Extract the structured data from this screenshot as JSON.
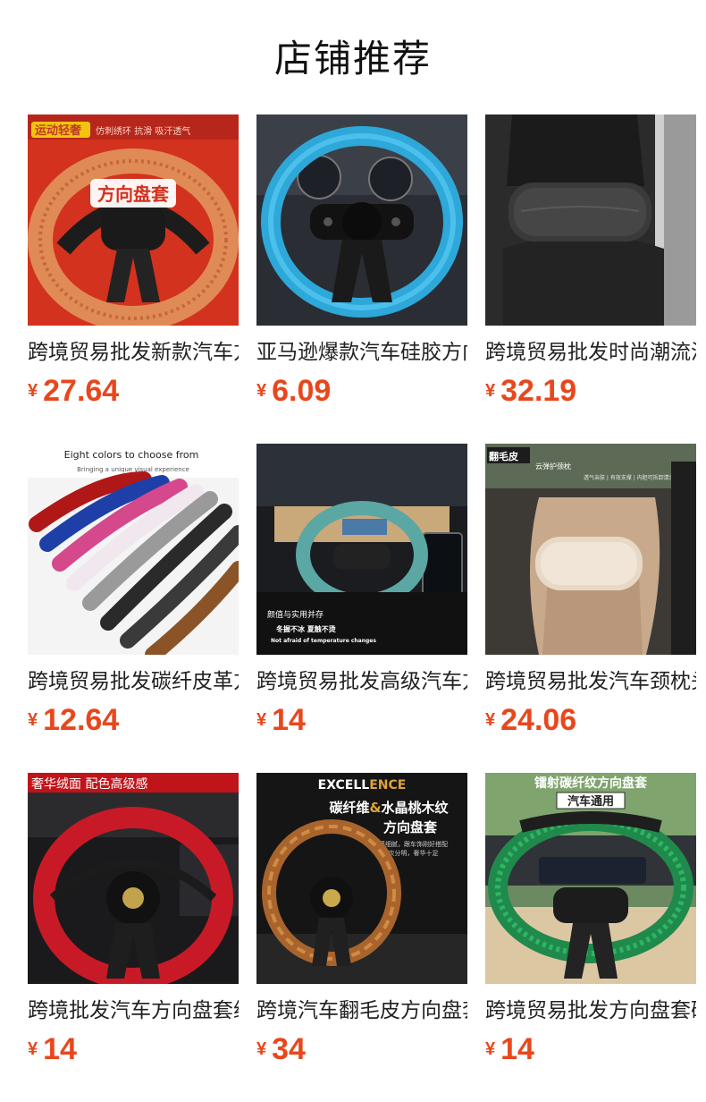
{
  "header": {
    "title": "店铺推荐"
  },
  "currency_symbol": "¥",
  "colors": {
    "price": "#e8471c"
  },
  "products": [
    {
      "title": "跨境贸易批发新款汽车方向盘套",
      "price": "27.64",
      "image": {
        "icon": "steering-wheel-cover-image",
        "badge": "运动轻奢",
        "tagline": "仿刺绣环 抗滑 吸汗透气",
        "headline": "方向盘套"
      }
    },
    {
      "title": "亚马逊爆款汽车硅胶方向盘套",
      "price": "6.09",
      "image": {
        "icon": "steering-wheel-cover-image"
      }
    },
    {
      "title": "跨境贸易批发时尚潮流汽车头枕",
      "price": "32.19",
      "image": {
        "icon": "headrest-pillow-image"
      }
    },
    {
      "title": "跨境贸易批发碳纤皮革方向盘套",
      "price": "12.64",
      "image": {
        "icon": "carbon-fiber-covers-image",
        "headline": "Eight colors to choose from",
        "subline": "Bringing a unique visual experience"
      }
    },
    {
      "title": "跨境贸易批发高级汽车方向盘套",
      "price": "14",
      "image": {
        "icon": "steering-wheel-cover-image",
        "line1": "颜值与实用并存",
        "line2": "冬握不冰   夏触不烫",
        "line3": "Not afraid of temperature changes"
      }
    },
    {
      "title": "跨境贸易批发汽车颈枕头枕",
      "price": "24.06",
      "image": {
        "icon": "neck-pillow-image",
        "badge": "翻毛皮",
        "tagline": "云弹护颈枕",
        "subline": "透气亲肤 | 有效支撑 | 内胆可拆卸清洗"
      }
    },
    {
      "title": "跨境批发汽车方向盘套绒面",
      "price": "14",
      "image": {
        "icon": "steering-wheel-cover-image",
        "banner": "奢华绒面 配色高级感"
      }
    },
    {
      "title": "跨境汽车翻毛皮方向盘套",
      "price": "34",
      "image": {
        "icon": "wood-steering-wheel-image",
        "brand_a": "EXCELL",
        "brand_b": "ENCE",
        "line1a": "碳纤维",
        "line1amp": "&",
        "line1b": "水晶桃木纹",
        "line2": "方向盘套",
        "note1": "质感细腻，跟车饰刚好搭配",
        "note2": "层次分明，奢华十足"
      }
    },
    {
      "title": "跨境贸易批发方向盘套碳纤维",
      "price": "14",
      "image": {
        "icon": "steering-wheel-cover-image",
        "headline": "镭射碳纤纹方向盘套",
        "tag": "汽车通用"
      }
    }
  ]
}
